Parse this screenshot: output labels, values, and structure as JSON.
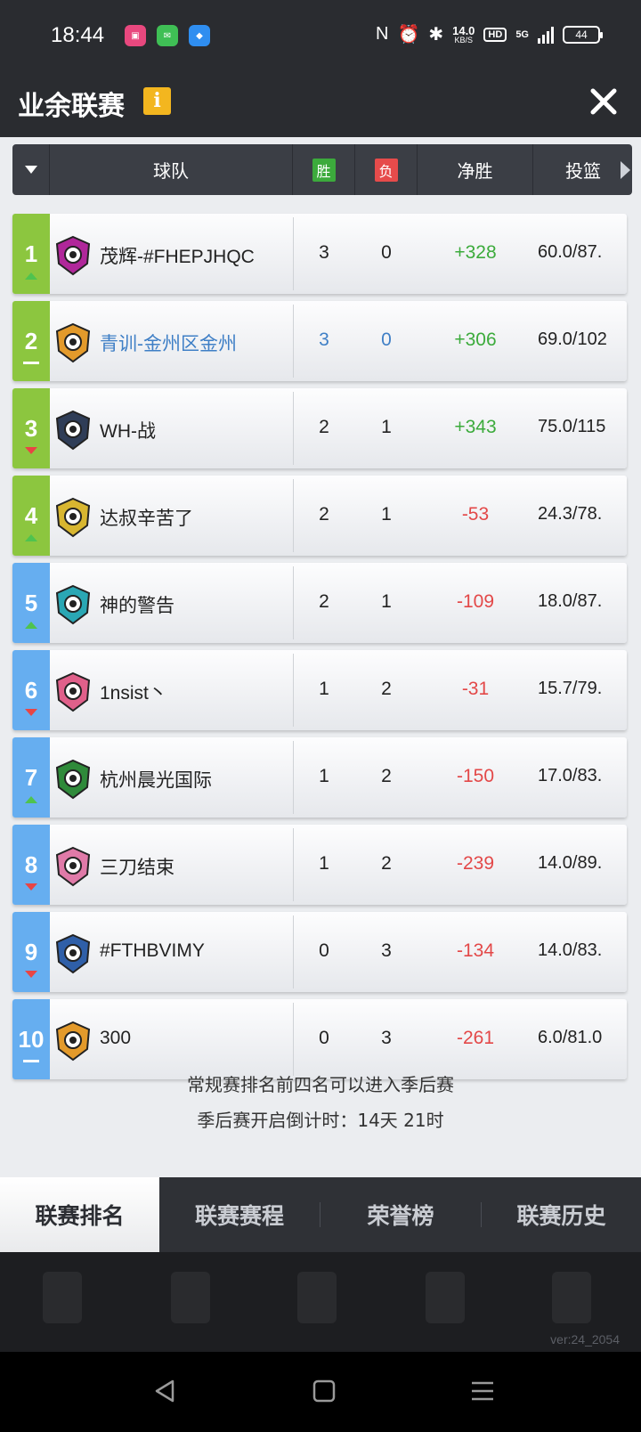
{
  "status_bar": {
    "time": "18:44",
    "net_speed_value": "14.0",
    "net_speed_unit": "KB/S",
    "hd_label": "HD",
    "network_label": "5G",
    "battery": "44"
  },
  "header": {
    "title": "业余联赛",
    "info_icon": "i"
  },
  "table": {
    "columns": {
      "team": "球队",
      "win": "胜",
      "loss": "负",
      "net": "净胜",
      "shooting": "投篮"
    },
    "rows": [
      {
        "rank": "1",
        "trend": "up",
        "team": "茂辉-#FHEPJHQC",
        "wins": "3",
        "losses": "0",
        "net": "+328",
        "shooting": "60.0/87.",
        "rank_color": "#8cc63f",
        "logo_color": "#b0279a"
      },
      {
        "rank": "2",
        "trend": "same",
        "team": "青训-金州区金州",
        "wins": "3",
        "losses": "0",
        "net": "+306",
        "shooting": "69.0/102",
        "rank_color": "#8cc63f",
        "logo_color": "#e39a2b"
      },
      {
        "rank": "3",
        "trend": "down",
        "team": "WH-战",
        "wins": "2",
        "losses": "1",
        "net": "+343",
        "shooting": "75.0/115",
        "rank_color": "#8cc63f",
        "logo_color": "#2f3d57"
      },
      {
        "rank": "4",
        "trend": "up",
        "team": "达叔辛苦了",
        "wins": "2",
        "losses": "1",
        "net": "-53",
        "shooting": "24.3/78.",
        "rank_color": "#8cc63f",
        "logo_color": "#d8b630"
      },
      {
        "rank": "5",
        "trend": "up",
        "team": "神的警告",
        "wins": "2",
        "losses": "1",
        "net": "-109",
        "shooting": "18.0/87.",
        "rank_color": "#66aef0",
        "logo_color": "#2aa7b4"
      },
      {
        "rank": "6",
        "trend": "down",
        "team": "1nsist丶",
        "wins": "1",
        "losses": "2",
        "net": "-31",
        "shooting": "15.7/79.",
        "rank_color": "#66aef0",
        "logo_color": "#e0608a"
      },
      {
        "rank": "7",
        "trend": "up",
        "team": "杭州晨光国际",
        "wins": "1",
        "losses": "2",
        "net": "-150",
        "shooting": "17.0/83.",
        "rank_color": "#66aef0",
        "logo_color": "#2f8a3a"
      },
      {
        "rank": "8",
        "trend": "down",
        "team": "三刀结束",
        "wins": "1",
        "losses": "2",
        "net": "-239",
        "shooting": "14.0/89.",
        "rank_color": "#66aef0",
        "logo_color": "#e07aa8"
      },
      {
        "rank": "9",
        "trend": "down",
        "team": "#FTHBVIMY",
        "wins": "0",
        "losses": "3",
        "net": "-134",
        "shooting": "14.0/83.",
        "rank_color": "#66aef0",
        "logo_color": "#2f5fa8"
      },
      {
        "rank": "10",
        "trend": "same",
        "team": "300",
        "wins": "0",
        "losses": "3",
        "net": "-261",
        "shooting": "6.0/81.0",
        "rank_color": "#66aef0",
        "logo_color": "#e39a2b"
      }
    ]
  },
  "notes": {
    "line1": "常规赛排名前四名可以进入季后赛",
    "line2": "季后赛开启倒计时：14天 21时"
  },
  "tabs": [
    {
      "label": "联赛排名",
      "active": true
    },
    {
      "label": "联赛赛程",
      "active": false
    },
    {
      "label": "荣誉榜",
      "active": false
    },
    {
      "label": "联赛历史",
      "active": false
    }
  ],
  "version": "ver:24_2054",
  "colors": {
    "positive": "#3cab3c",
    "negative": "#e34848",
    "highlight": "#3f7fc6",
    "playoff_rank": "#8cc63f",
    "other_rank": "#66aef0"
  }
}
